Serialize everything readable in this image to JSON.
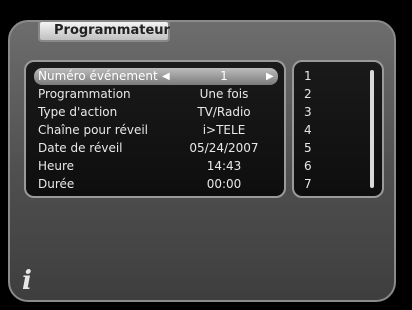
{
  "title": "Programmateur",
  "event_number": {
    "label": "Numéro événement",
    "value": "1"
  },
  "settings": [
    {
      "label": "Programmation",
      "value": "Une fois"
    },
    {
      "label": "Type d'action",
      "value": "TV/Radio"
    },
    {
      "label": "Chaîne pour réveil",
      "value": "i>TELE"
    },
    {
      "label": "Date de réveil",
      "value": "05/24/2007"
    },
    {
      "label": "Heure",
      "value": "14:43"
    },
    {
      "label": "Durée",
      "value": "00:00"
    }
  ],
  "events": [
    "1",
    "2",
    "3",
    "4",
    "5",
    "6",
    "7"
  ],
  "info_icon": "i",
  "icons": {
    "left": "arrow-left-icon",
    "right": "arrow-right-icon",
    "info": "info-icon"
  }
}
